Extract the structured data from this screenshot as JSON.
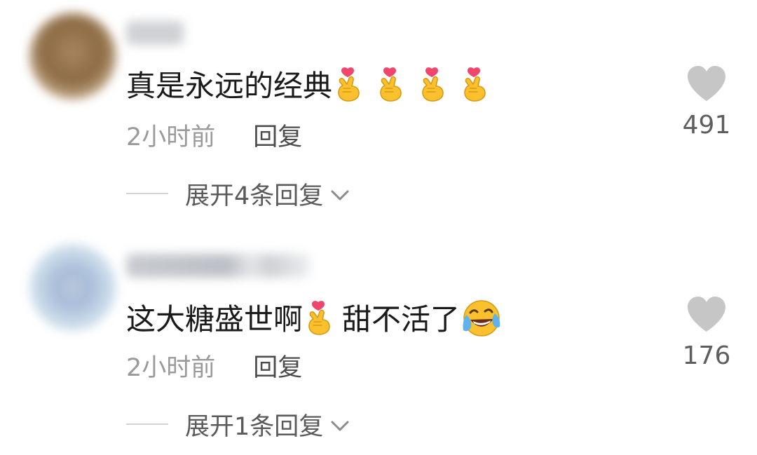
{
  "comments": [
    {
      "text": "真是永远的经典",
      "emoji_sequence": [
        "heart-fingers-icon",
        "heart-fingers-icon",
        "heart-fingers-icon",
        "heart-fingers-icon"
      ],
      "time": "2小时前",
      "reply_label": "回复",
      "like_count": "491",
      "expand_label": "展开4条回复"
    },
    {
      "text_before": "这大糖盛世啊",
      "text_after": "甜不活了",
      "emoji_sequence": [
        "heart-fingers-icon",
        "rolling-laughing-icon"
      ],
      "time": "2小时前",
      "reply_label": "回复",
      "like_count": "176",
      "expand_label": "展开1条回复"
    }
  ],
  "colors": {
    "text_primary": "#1a1a1a",
    "text_secondary": "#9a9a9a",
    "like_icon": "#c6c6c6",
    "emoji_yellow": "#fbc02d",
    "emoji_heart": "#f0466e"
  }
}
